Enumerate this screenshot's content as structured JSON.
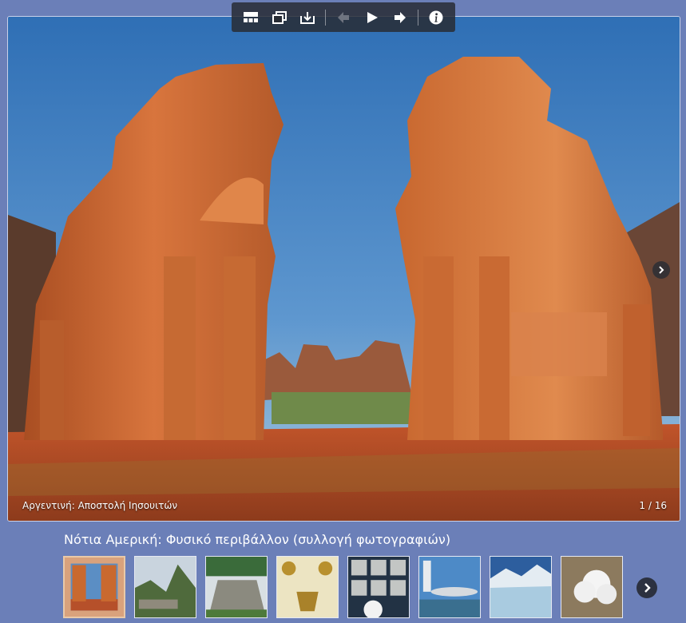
{
  "toolbar": {
    "buttons": [
      {
        "name": "thumbnails-icon",
        "label": "thumbnails"
      },
      {
        "name": "fullscreen-icon",
        "label": "fullscreen"
      },
      {
        "name": "download-icon",
        "label": "download"
      },
      {
        "name": "previous-icon",
        "label": "previous"
      },
      {
        "name": "play-icon",
        "label": "play slideshow"
      },
      {
        "name": "next-icon",
        "label": "next"
      },
      {
        "name": "info-icon",
        "label": "info"
      }
    ]
  },
  "viewer": {
    "caption": "Αργεντινή: Αποστολή Ιησουιτών",
    "counter": "1 / 16"
  },
  "gallery": {
    "title": "Νότια Αμερική: Φυσικό περιβάλλον (συλλογή φωτογραφιών)",
    "thumbnails": [
      {
        "subject": "jesuit-mission-ruins",
        "active": true
      },
      {
        "subject": "machu-picchu",
        "active": false
      },
      {
        "subject": "maya-pyramid",
        "active": false
      },
      {
        "subject": "gold-artifacts",
        "active": false
      },
      {
        "subject": "museum-display",
        "active": false
      },
      {
        "subject": "modern-architecture",
        "active": false
      },
      {
        "subject": "glacier",
        "active": false
      },
      {
        "subject": "clouds-aerial",
        "active": false
      }
    ]
  },
  "colors": {
    "page_bg": "#6b7fb8",
    "toolbar_bg": "#282c34",
    "sky": "#3f7fc4",
    "stone": "#c4622e",
    "ground": "#b34a22"
  }
}
